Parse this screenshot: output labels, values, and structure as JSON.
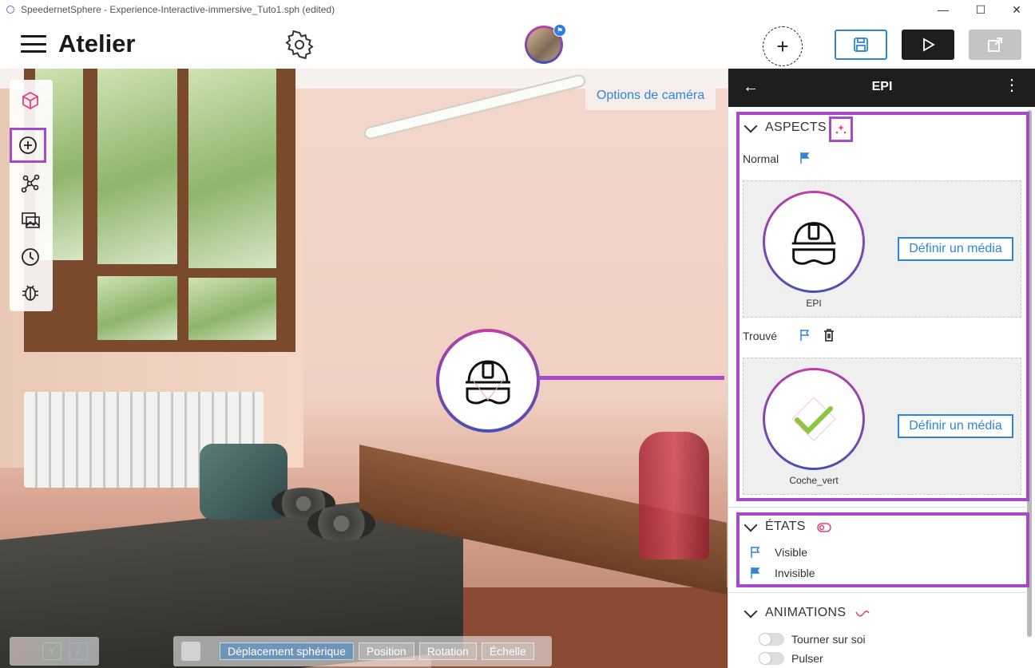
{
  "window": {
    "title": "SpeedernetSphere - Experience-Interactive-immersive_Tuto1.sph (edited)",
    "minimize": "—",
    "maximize": "☐",
    "close": "✕"
  },
  "header": {
    "title": "Atelier",
    "add_scene": "+"
  },
  "viewport": {
    "camera_options": "Options de caméra"
  },
  "axes": {
    "x": "X",
    "y": "Y",
    "z": "Z",
    "colors": {
      "x": "#e58a95",
      "y": "#9fd08b",
      "z": "#9ab8dc"
    }
  },
  "transform_modes": [
    "Déplacement sphérique",
    "Position",
    "Rotation",
    "Échelle"
  ],
  "panel": {
    "title": "EPI",
    "back": "←",
    "menu": "⋮",
    "aspects": {
      "title": "ASPECTS",
      "items": [
        {
          "label": "Normal",
          "media_name": "EPI",
          "button": "Définir un média"
        },
        {
          "label": "Trouvé",
          "media_name": "Coche_vert",
          "button": "Définir un média"
        }
      ]
    },
    "states": {
      "title": "ÉTATS",
      "items": [
        "Visible",
        "Invisible"
      ]
    },
    "animations": {
      "title": "ANIMATIONS",
      "items": [
        "Tourner sur soi",
        "Pulser"
      ]
    }
  },
  "colors": {
    "accent": "#a64ac9",
    "link": "#2f86d8",
    "dark": "#1e1e1e"
  }
}
